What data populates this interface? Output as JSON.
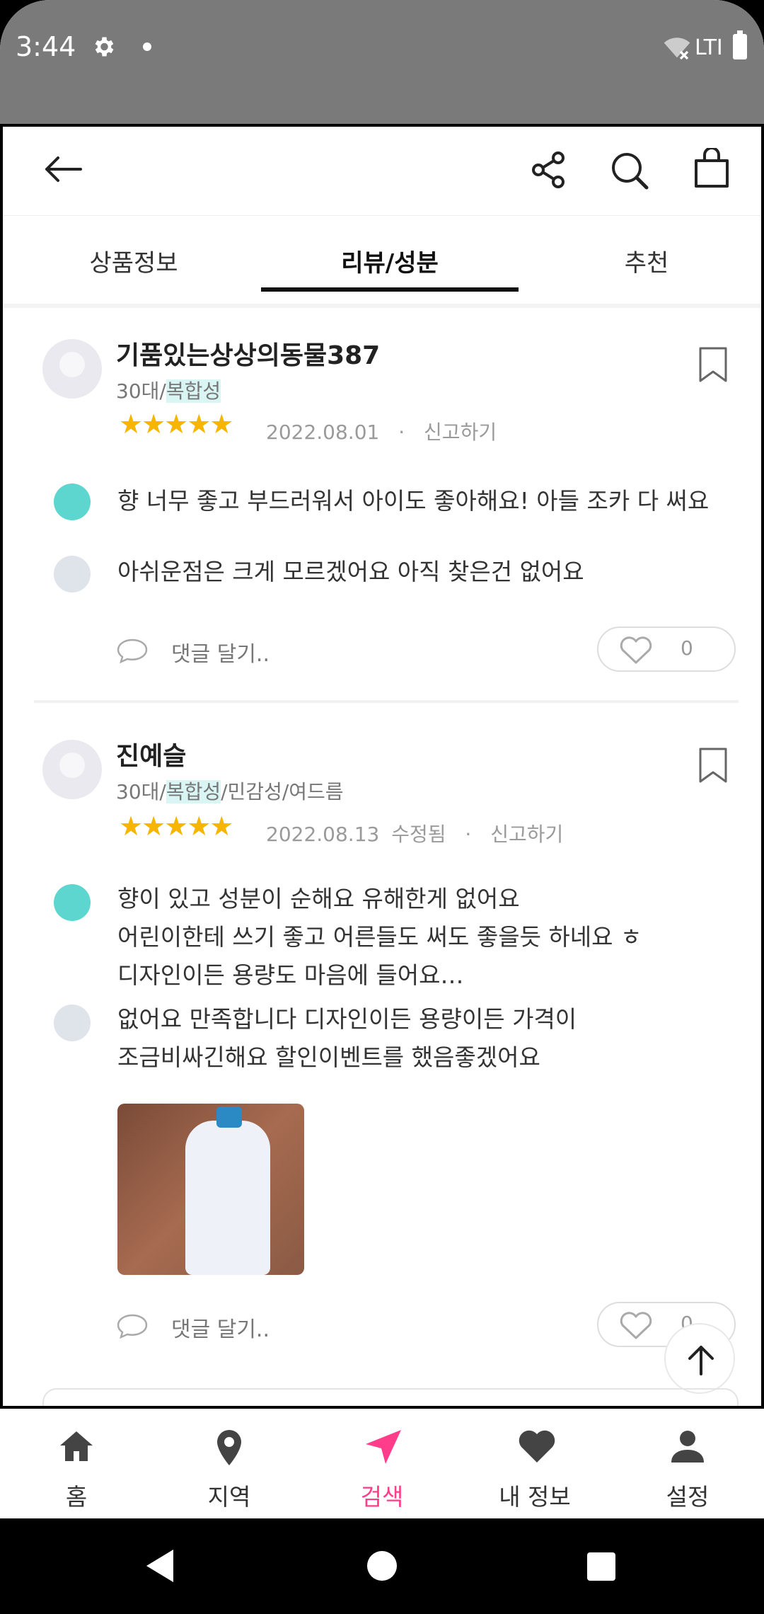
{
  "status": {
    "time": "3:44",
    "network": "LTI"
  },
  "tabs": [
    {
      "label": "상품정보"
    },
    {
      "label": "리뷰/성분"
    },
    {
      "label": "추천"
    }
  ],
  "reviews": [
    {
      "name": "기품있는상상의동물387",
      "meta_prefix": "30대/",
      "meta_highlight": "복합성",
      "meta_suffix": "",
      "stars": "★★★★★",
      "date": "2022.08.01",
      "edited": "",
      "report": "신고하기",
      "pos_text": [
        "향 너무 좋고 부드러워서 아이도 좋아해요! 아들 조카 다 써요"
      ],
      "neg_text": [
        "아쉬운점은 크게 모르겠어요 아직 찾은건 없어요"
      ],
      "comment_label": "댓글 달기..",
      "likes": "0"
    },
    {
      "name": "진예슬",
      "meta_prefix": "30대/",
      "meta_highlight": "복합성",
      "meta_suffix": "/민감성/여드름",
      "stars": "★★★★★",
      "date": "2022.08.13",
      "edited": "수정됨",
      "report": "신고하기",
      "pos_text": [
        "향이 있고 성분이 순해요 유해한게 없어요",
        "어린이한테 쓰기 좋고 어른들도 써도 좋을듯 하네요 ㅎ",
        "디자인이든 용량도 마음에 들어요…"
      ],
      "neg_text": [
        "없어요 만족합니다 디자인이든 용량이든 가격이",
        "조금비싸긴해요 할인이벤트를 했음좋겠어요"
      ],
      "comment_label": "댓글 달기..",
      "likes": "0"
    }
  ],
  "bottom_nav": [
    {
      "label": "홈",
      "icon": "home-icon"
    },
    {
      "label": "지역",
      "icon": "location-pin-icon"
    },
    {
      "label": "검색",
      "icon": "navigation-arrow-icon"
    },
    {
      "label": "내 정보",
      "icon": "heart-icon"
    },
    {
      "label": "설정",
      "icon": "person-icon"
    }
  ],
  "colors": {
    "accent": "#ff3d8b",
    "star": "#f7b500",
    "positive": "#5ed6d0",
    "highlight": "#d9f5f4"
  }
}
